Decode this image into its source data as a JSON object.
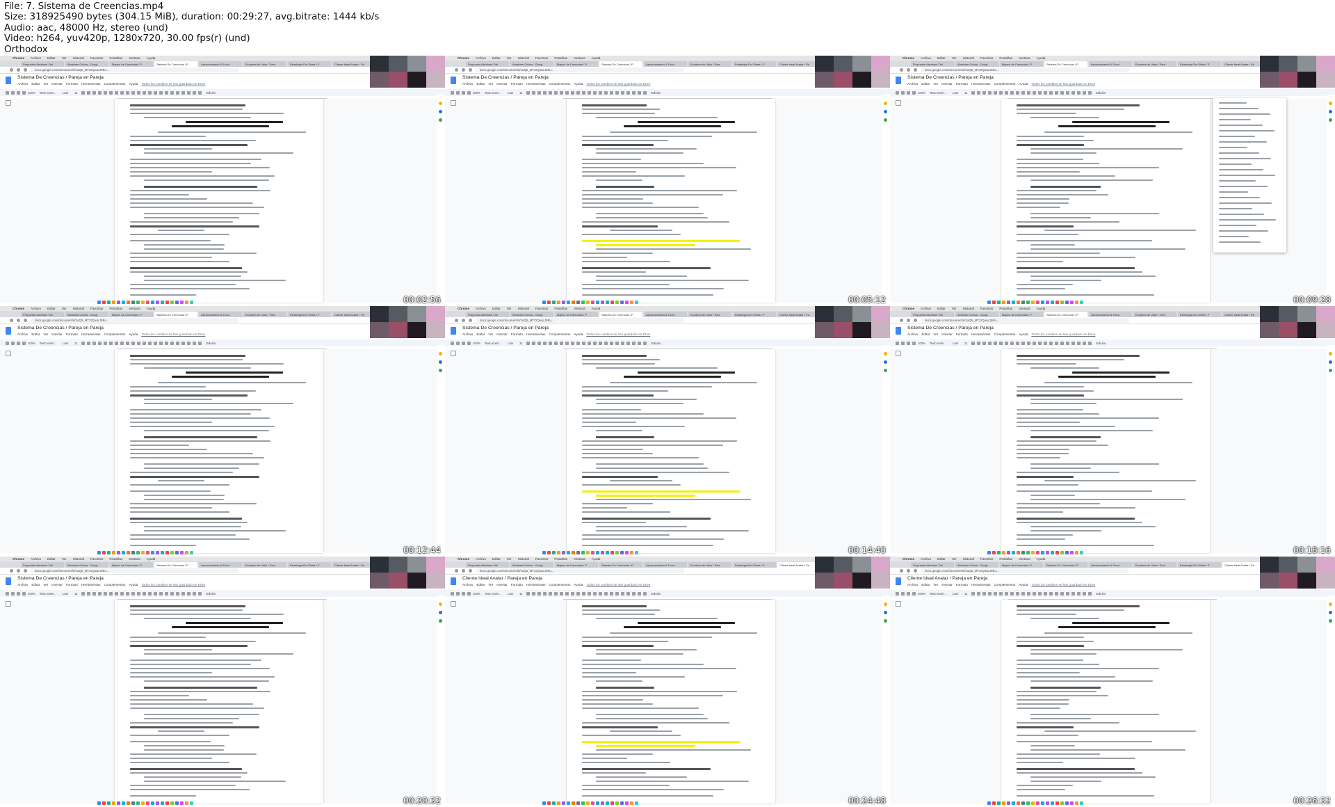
{
  "header": {
    "file": "File: 7. Sistema de Creencias.mp4",
    "size": "Size: 318925490 bytes (304.15 MiB), duration: 00:29:27, avg.bitrate: 1444 kb/s",
    "audio": "Audio: aac, 48000 Hz, stereo (und)",
    "video": "Video: h264, yuv420p, 1280x720, 30.00 fps(r) (und)",
    "brand": "Orthodox"
  },
  "docs_ui": {
    "macmenu": [
      "Chrome",
      "Archivo",
      "Editar",
      "Ver",
      "Historial",
      "Favoritos",
      "Pestañas",
      "Ventana",
      "Ayuda"
    ],
    "tabs": [
      "Propuesta Abraham Orti",
      "Abraham Ochoa - Googl",
      "Mapeo de Creencias / P",
      "Sistema De Creencias / P",
      "Asesoramiento & Funci",
      "Escalera de Valor / Pare",
      "Estrategia De Oferta / P",
      "Cliente Ideal Avatar / Pa"
    ],
    "url": "docs.google.com/document/d/1aQ5_MTZrQuaLJ9Eu...",
    "menus": [
      "Archivo",
      "Editar",
      "Ver",
      "Insertar",
      "Formato",
      "Herramientas",
      "Complementos",
      "Ayuda"
    ],
    "saved": "Todos los cambios se han guardado en Drive",
    "zoom": "100%",
    "style": "Texto norm...",
    "font": "Lato",
    "size": "11",
    "mode": "Edición"
  },
  "tiles": [
    {
      "title": "Sistema De Creencias / Pareja en Pareja",
      "time": "00:02:56",
      "page": 1,
      "active_tab": 3
    },
    {
      "title": "Sistema De Creencias / Pareja en Pareja",
      "time": "00:05:12",
      "page": 2,
      "active_tab": 3
    },
    {
      "title": "Sistema De Creencias / Pareja en Pareja",
      "time": "00:09:28",
      "page": 3,
      "active_tab": 3,
      "context_menu": true
    },
    {
      "title": "Sistema De Creencias / Pareja en Pareja",
      "time": "00:12:44",
      "page": 1,
      "active_tab": 3
    },
    {
      "title": "Sistema De Creencias / Pareja en Pareja",
      "time": "00:14:40",
      "page": 2,
      "active_tab": 3
    },
    {
      "title": "Sistema De Creencias / Pareja en Pareja",
      "time": "00:18:16",
      "page": 3,
      "active_tab": 3
    },
    {
      "title": "Sistema De Creencias / Pareja en Pareja",
      "time": "00:20:32",
      "page": 1,
      "active_tab": 3
    },
    {
      "title": "Cliente Ideal Avatar / Pareja en Pareja",
      "time": "00:24:48",
      "page": 2,
      "active_tab": 7
    },
    {
      "title": "Cliente Ideal Avatar / Pareja en Pareja",
      "time": "00:26:32",
      "page": 3,
      "active_tab": 7
    }
  ],
  "video_colors": [
    "#2b2f38",
    "#555a63",
    "#8b8f96",
    "#d9a7c9",
    "#6e5a68",
    "#9a4e68",
    "#201a22",
    "#c8b3c0"
  ]
}
